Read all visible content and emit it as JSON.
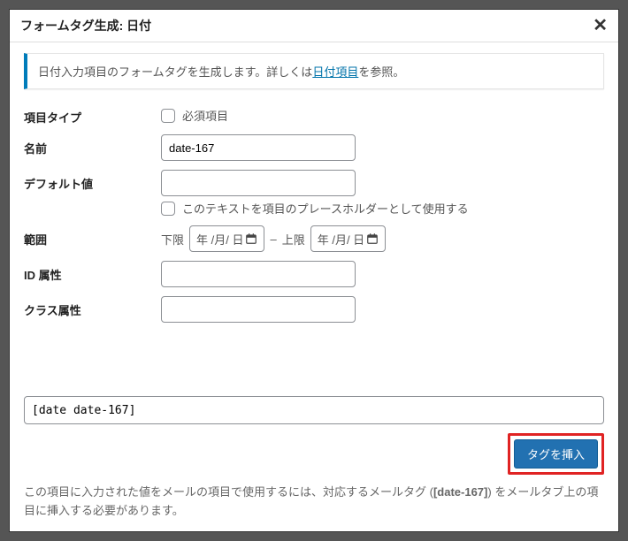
{
  "header": {
    "title": "フォームタグ生成: 日付"
  },
  "info": {
    "prefix": "日付入力項目のフォームタグを生成します。詳しくは",
    "link": "日付項目",
    "suffix": "を参照。"
  },
  "fields": {
    "type": {
      "label": "項目タイプ",
      "required_checkbox": "必須項目"
    },
    "name": {
      "label": "名前",
      "value": "date-167"
    },
    "default": {
      "label": "デフォルト値",
      "value": "",
      "placeholder_checkbox": "このテキストを項目のプレースホルダーとして使用する"
    },
    "range": {
      "label": "範囲",
      "min_label": "下限",
      "max_label": "上限",
      "date_placeholder": "年 /月/ 日",
      "separator": "–"
    },
    "id": {
      "label": "ID 属性",
      "value": ""
    },
    "class": {
      "label": "クラス属性",
      "value": ""
    }
  },
  "result": {
    "value": "[date date-167]"
  },
  "insert_button": "タグを挿入",
  "footer": {
    "p1": "この項目に入力された値をメールの項目で使用するには、対応するメールタグ (",
    "tag": "[date-167]",
    "p2": ") をメールタブ上の項目に挿入する必要があります。"
  }
}
